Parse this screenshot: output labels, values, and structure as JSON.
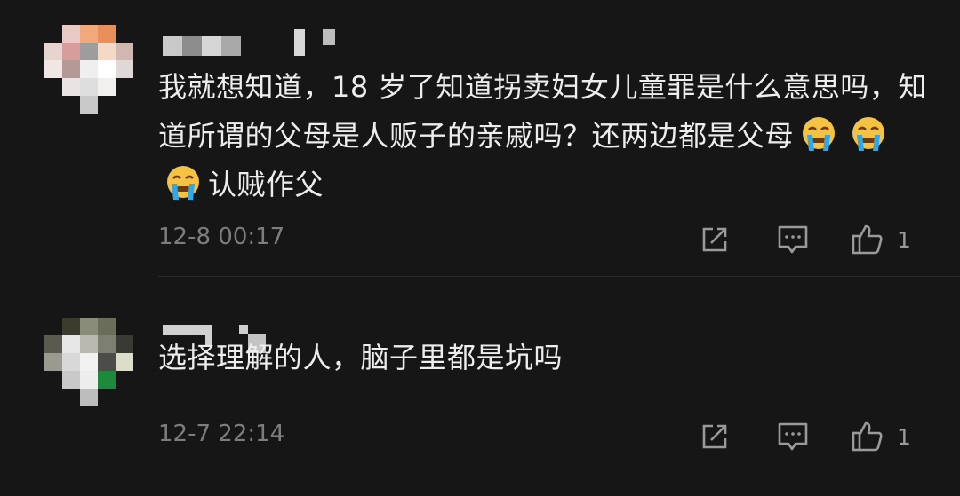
{
  "comments": [
    {
      "text_parts": [
        "我就想知道，18 岁了知道拐卖妇女儿童罪是什么意思吗，知道所谓的父母是人贩子的亲戚吗？还两边都是父母",
        "认贼作父"
      ],
      "emoji": [
        "crying-face-emoji",
        "crying-face-emoji",
        "crying-face-emoji"
      ],
      "time": "12-8 00:17",
      "likes": "1"
    },
    {
      "text": "选择理解的人，脑子里都是坑吗",
      "time": "12-7 22:14",
      "likes": "1"
    }
  ],
  "colors": {
    "background": "#161616",
    "text": "#ededed",
    "meta": "#7d7d7d",
    "icon": "#9a9a9a"
  }
}
